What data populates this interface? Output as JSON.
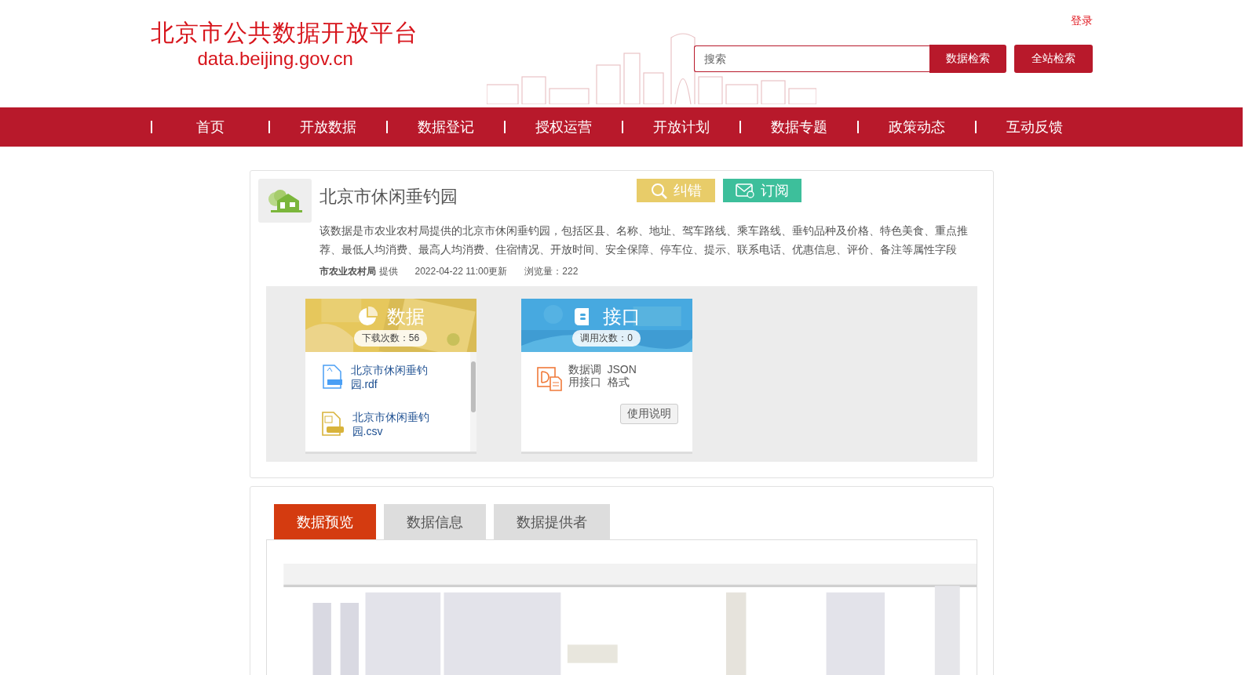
{
  "header": {
    "logo_title": "北京市公共数据开放平台",
    "logo_url": "data.beijing.gov.cn",
    "login": "登录",
    "search": {
      "placeholder": "搜索"
    },
    "buttons": [
      "数据检索",
      "全站检索"
    ]
  },
  "nav": [
    "首页",
    "开放数据",
    "数据登记",
    "授权运营",
    "开放计划",
    "数据专题",
    "政策动态",
    "互动反馈"
  ],
  "dataset": {
    "title": "北京市休闲垂钓园",
    "actions": [
      {
        "kind": "report",
        "label": "纠错"
      },
      {
        "kind": "subscribe",
        "label": "订阅"
      }
    ],
    "description": "该数据是市农业农村局提供的北京市休闲垂钓园，包括区县、名称、地址、驾车路线、乘车路线、垂钓品种及价格、特色美食、重点推荐、最低人均消费、最高人均消费、住宿情况、开放时间、安全保障、停车位、提示、联系电话、优惠信息、评价、备注等属性字段",
    "provider": "市农业农村局",
    "provider_suffix": "提供",
    "updated": "2022-04-22 11:00更新",
    "views": "浏览量：222"
  },
  "data_card": {
    "title": "数据",
    "count": "下载次数：56",
    "files": [
      {
        "kind": "rdf",
        "name": "北京市休闲垂钓园.rdf"
      },
      {
        "kind": "csv",
        "name": "北京市休闲垂钓园.csv"
      }
    ]
  },
  "api_card": {
    "title": "接口",
    "count": "调用次数：0",
    "name": "数据调用接口",
    "format": "JSON格式",
    "help": "使用说明"
  },
  "tabs": [
    {
      "label": "数据预览",
      "selected": true
    },
    {
      "label": "数据信息",
      "selected": false
    },
    {
      "label": "数据提供者",
      "selected": false
    }
  ]
}
